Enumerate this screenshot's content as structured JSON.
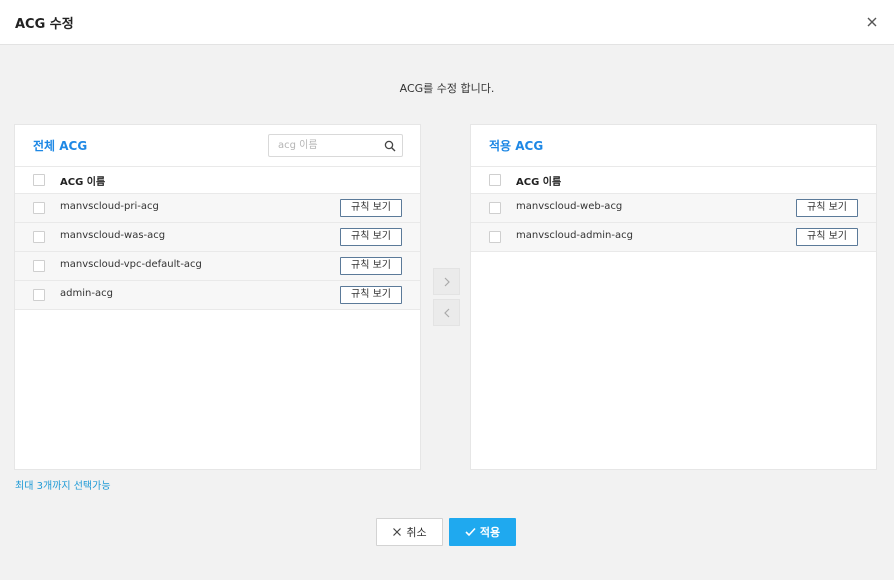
{
  "dialog": {
    "title": "ACG 수정",
    "description": "ACG를 수정 합니다."
  },
  "left_panel": {
    "title": "전체 ACG",
    "search_placeholder": "acg 이름",
    "search_value": "",
    "column_header": "ACG 이름",
    "rows": [
      {
        "name": "manvscloud-pri-acg",
        "button": "규칙 보기"
      },
      {
        "name": "manvscloud-was-acg",
        "button": "규칙 보기"
      },
      {
        "name": "manvscloud-vpc-default-acg",
        "button": "규칙 보기"
      },
      {
        "name": "admin-acg",
        "button": "규칙 보기"
      }
    ]
  },
  "right_panel": {
    "title": "적용 ACG",
    "column_header": "ACG 이름",
    "rows": [
      {
        "name": "manvscloud-web-acg",
        "button": "규칙 보기"
      },
      {
        "name": "manvscloud-admin-acg",
        "button": "규칙 보기"
      }
    ]
  },
  "note": "최대 3개까지 선택가능",
  "footer": {
    "cancel_label": "취소",
    "apply_label": "적용"
  },
  "colors": {
    "accent": "#1e88e5",
    "apply_button": "#1fa9ef",
    "note": "#1e9ad6"
  },
  "icons": {
    "close": "close-icon",
    "search": "search-icon",
    "move_right": "chevron-right-icon",
    "move_left": "chevron-left-icon",
    "cancel": "x-icon",
    "apply": "check-icon"
  }
}
